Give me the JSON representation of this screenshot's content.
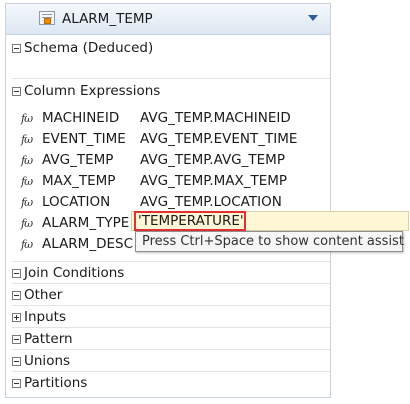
{
  "header": {
    "title": "ALARM_TEMP",
    "icon": "calculation-node-icon",
    "menu_icon": "chevron-down-icon"
  },
  "sections": {
    "schema": {
      "label": "Schema (Deduced)",
      "state": "collapsed"
    },
    "column_expressions": {
      "label": "Column Expressions",
      "state": "expanded"
    },
    "join_conditions": {
      "label": "Join Conditions",
      "state": "collapsed"
    },
    "other": {
      "label": "Other",
      "state": "collapsed"
    },
    "inputs": {
      "label": "Inputs",
      "state": "expandable"
    },
    "pattern": {
      "label": "Pattern",
      "state": "collapsed"
    },
    "unions": {
      "label": "Unions",
      "state": "collapsed"
    },
    "partitions": {
      "label": "Partitions",
      "state": "collapsed"
    }
  },
  "expressions": [
    {
      "name": "MACHINEID",
      "value": "AVG_TEMP.MACHINEID"
    },
    {
      "name": "EVENT_TIME",
      "value": "AVG_TEMP.EVENT_TIME"
    },
    {
      "name": "AVG_TEMP",
      "value": "AVG_TEMP.AVG_TEMP"
    },
    {
      "name": "MAX_TEMP",
      "value": "AVG_TEMP.MAX_TEMP"
    },
    {
      "name": "LOCATION",
      "value": "AVG_TEMP.LOCATION"
    },
    {
      "name": "ALARM_TYPE",
      "value": "'TEMPERATURE'"
    },
    {
      "name": "ALARM_DESC",
      "value": ""
    }
  ],
  "tooltip": {
    "text": "Press Ctrl+Space to show content assist"
  },
  "colors": {
    "highlight_border": "#e53030",
    "edit_background": "#fff7d6",
    "header_gradient": "#dde7f2"
  }
}
